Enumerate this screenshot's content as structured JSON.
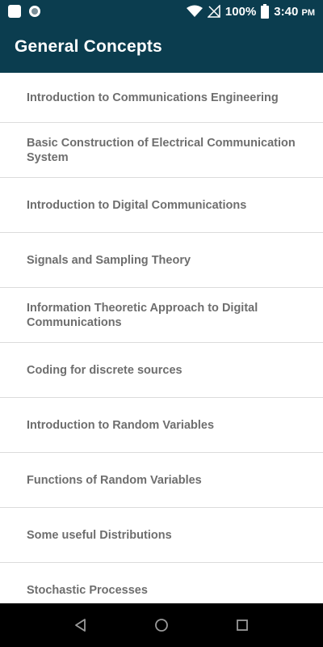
{
  "status_bar": {
    "battery_text": "100%",
    "time": "3:40",
    "time_suffix": "PM",
    "icons": [
      "app-notification-icon",
      "circle-notification-icon",
      "wifi-icon",
      "no-signal-icon",
      "battery-icon"
    ]
  },
  "header": {
    "title": "General Concepts"
  },
  "topics": [
    "Introduction to Communications Engineering",
    "Basic Construction of Electrical Communication System",
    "Introduction to Digital Communications",
    "Signals and Sampling Theory",
    "Information Theoretic Approach to Digital Communications",
    "Coding for discrete sources",
    "Introduction to Random Variables",
    "Functions of Random Variables",
    "Some useful Distributions",
    "Stochastic Processes"
  ],
  "nav_bar": {
    "icons": [
      "back-icon",
      "home-icon",
      "recents-icon"
    ]
  },
  "colors": {
    "app_bar": "#0b3d4f",
    "item_text": "#6e6e6e",
    "divider": "#dcdcdc"
  }
}
